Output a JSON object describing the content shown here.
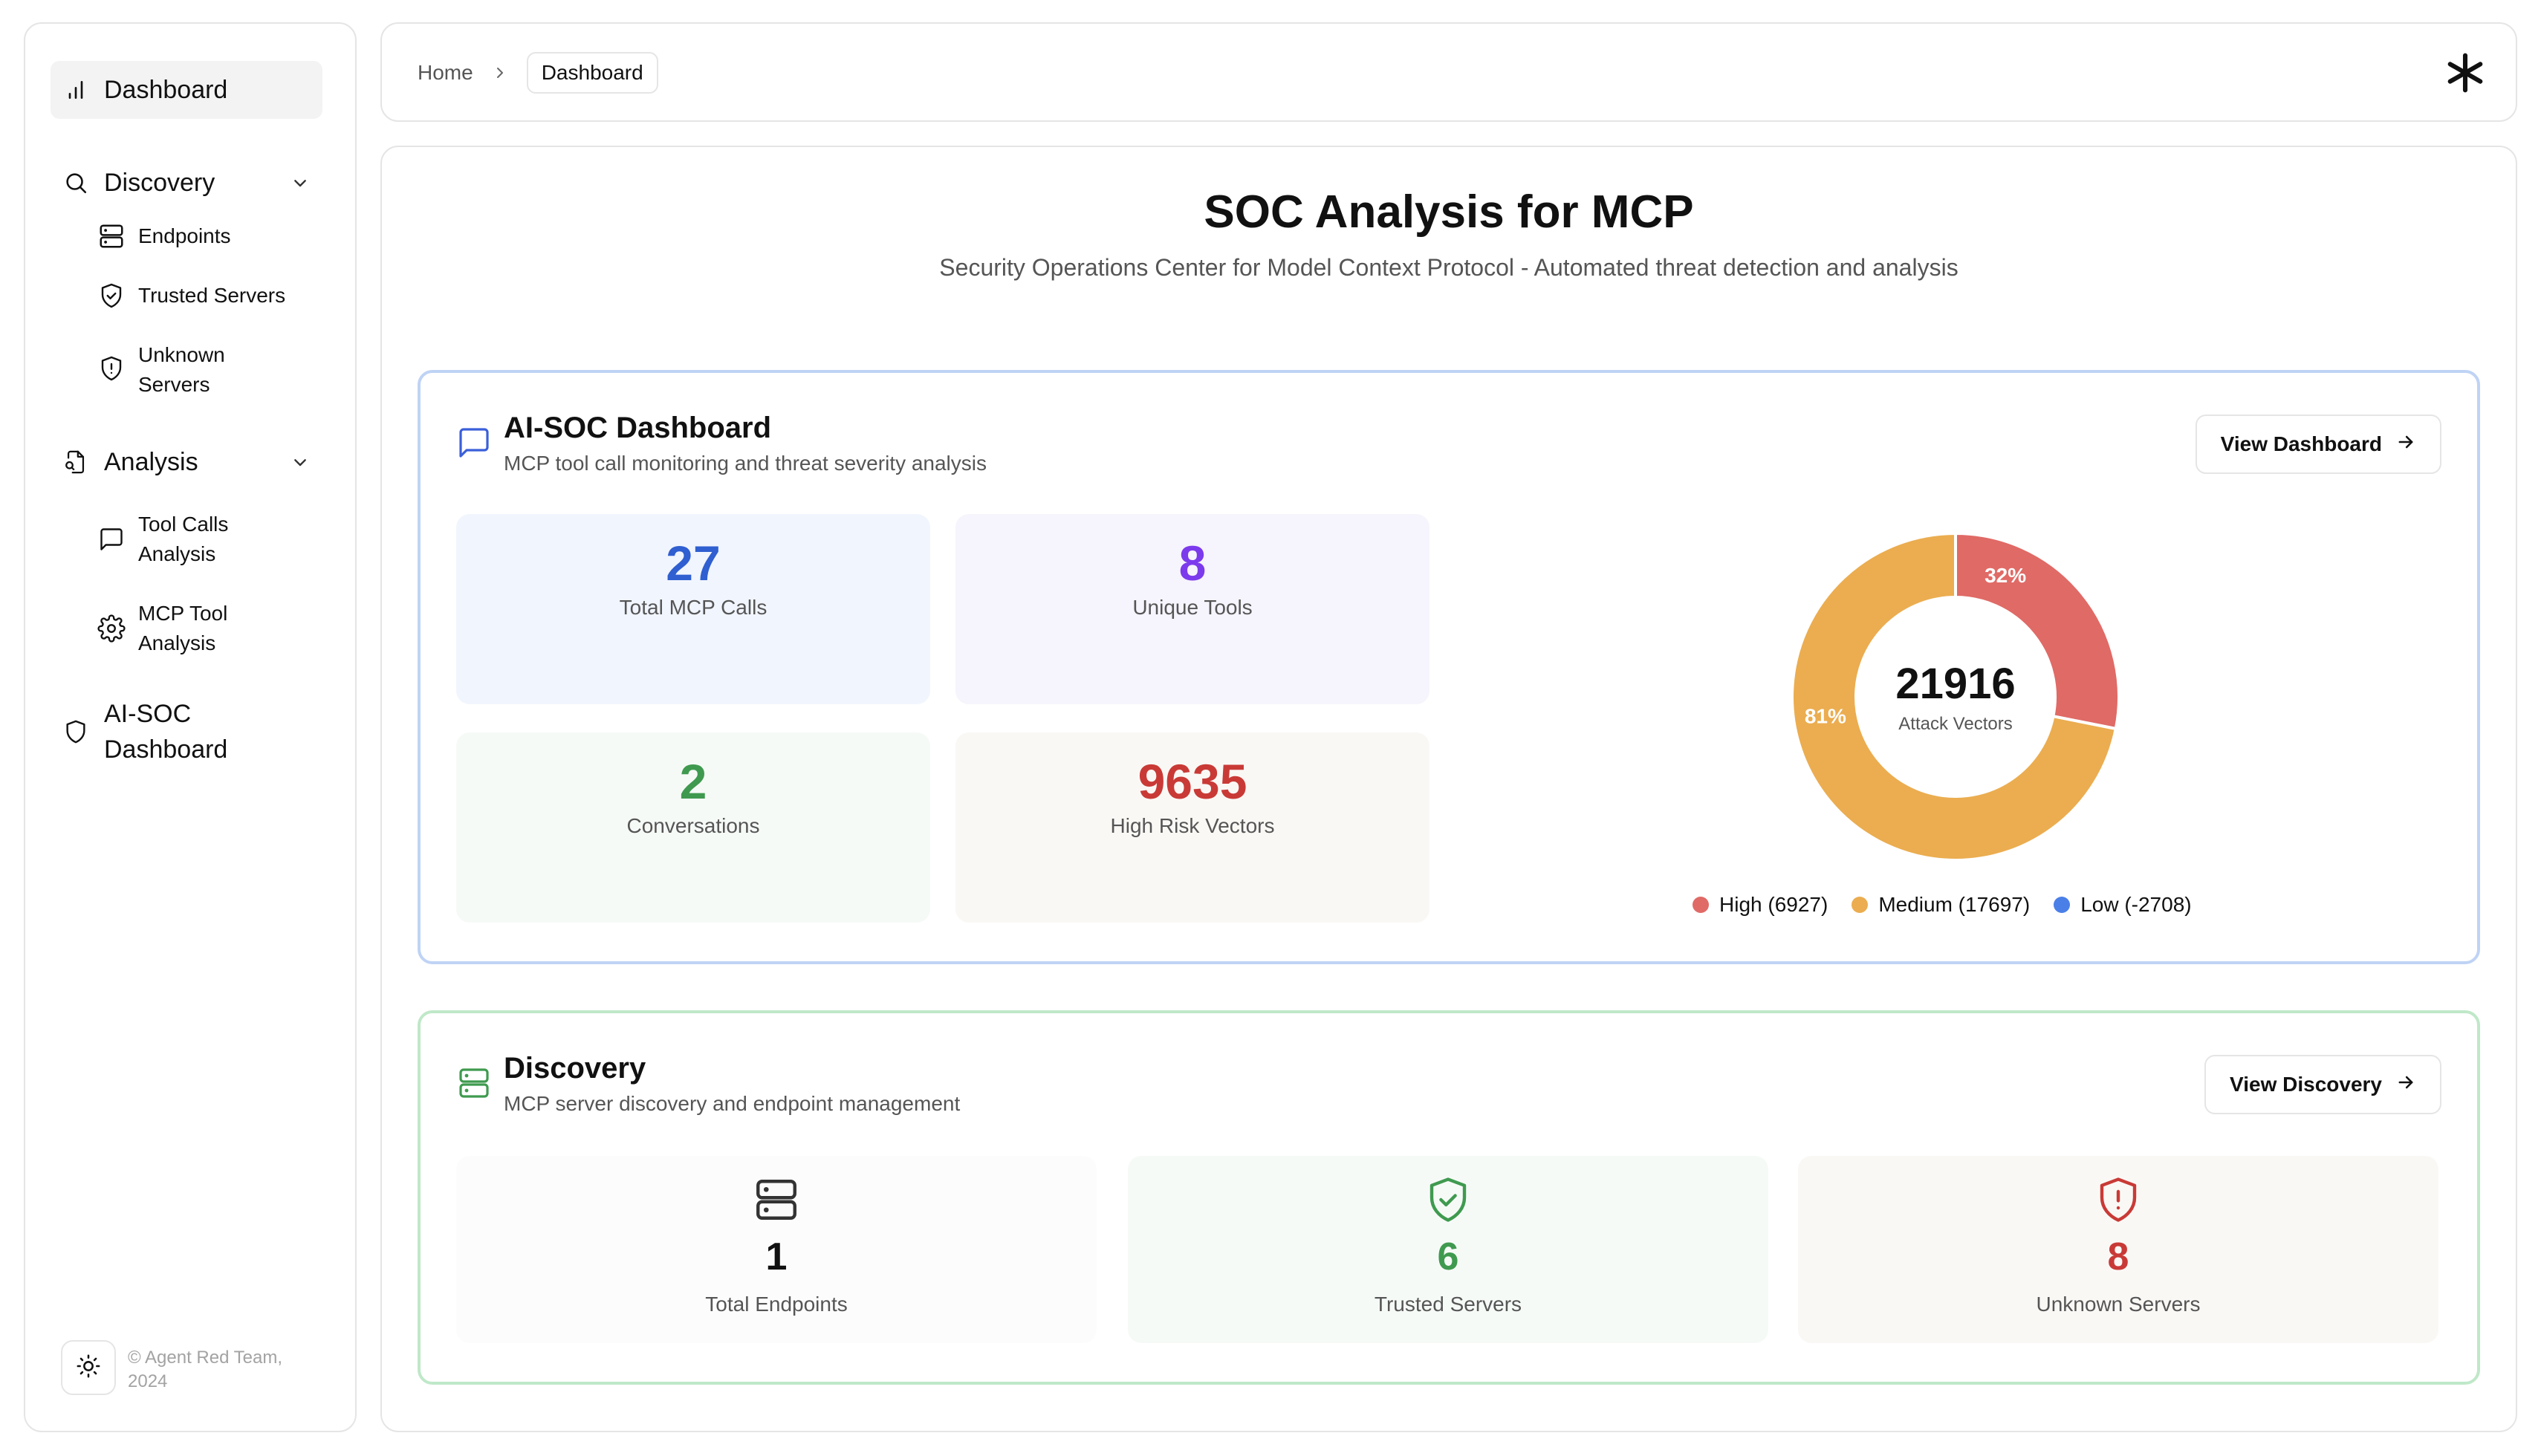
{
  "sidebar": {
    "items": [
      {
        "label": "Dashboard"
      },
      {
        "label": "Discovery"
      },
      {
        "label": "Endpoints"
      },
      {
        "label": "Trusted Servers"
      },
      {
        "label": "Unknown Servers"
      },
      {
        "label": "Analysis"
      },
      {
        "label": "Tool Calls Analysis"
      },
      {
        "label": "MCP Tool Analysis"
      },
      {
        "label": "AI-SOC Dashboard"
      }
    ],
    "footer": "© Agent Red Team, 2024"
  },
  "header": {
    "breadcrumb": {
      "home": "Home",
      "current": "Dashboard"
    }
  },
  "main": {
    "title": "SOC Analysis for MCP",
    "subtitle": "Security Operations Center for Model Context Protocol - Automated threat detection and analysis"
  },
  "soc": {
    "title": "AI-SOC Dashboard",
    "subtitle": "MCP tool call monitoring and threat severity analysis",
    "button": "View Dashboard",
    "stats": [
      {
        "value": "27",
        "label": "Total MCP Calls",
        "color": "#2f5fd0"
      },
      {
        "value": "8",
        "label": "Unique Tools",
        "color": "#7c3aed"
      },
      {
        "value": "2",
        "label": "Conversations",
        "color": "#3f9a4f"
      },
      {
        "value": "9635",
        "label": "High Risk Vectors",
        "color": "#c93a36"
      }
    ]
  },
  "chart_data": {
    "type": "pie",
    "center_value": "21916",
    "center_label": "Attack Vectors",
    "slices": [
      {
        "name": "High",
        "value": 6927,
        "pct_label": "32%",
        "color": "#e06a66"
      },
      {
        "name": "Medium",
        "value": 17697,
        "pct_label": "81%",
        "color": "#ebad50"
      },
      {
        "name": "Low",
        "value": -2708,
        "pct_label": "",
        "color": "#4a7fe8"
      }
    ],
    "legend": [
      "High (6927)",
      "Medium (17697)",
      "Low (-2708)"
    ],
    "legend_position": "bottom"
  },
  "discovery": {
    "title": "Discovery",
    "subtitle": "MCP server discovery and endpoint management",
    "button": "View Discovery",
    "stats": [
      {
        "value": "1",
        "label": "Total Endpoints",
        "color": "#111111"
      },
      {
        "value": "6",
        "label": "Trusted Servers",
        "color": "#3f9a4f"
      },
      {
        "value": "8",
        "label": "Unknown Servers",
        "color": "#c93a36"
      }
    ]
  }
}
